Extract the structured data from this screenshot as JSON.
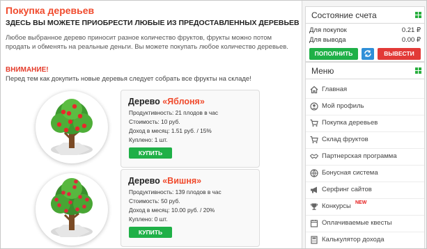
{
  "page": {
    "title": "Покупка деревьев",
    "subtitle": "ЗДЕСЬ ВЫ МОЖЕТЕ ПРИОБРЕСТИ ЛЮБЫЕ ИЗ ПРЕДОСТАВЛЕННЫХ ДЕРЕВЬЕВ",
    "intro": "Любое выбранное дерево приносит разное количество фруктов, фрукты можно потом продать и обменять на реальные деньги. Вы можете покупать любое количество деревьев.",
    "warning_title": "ВНИМАНИЕ!",
    "warning_text": "Перед тем как докупить новые деревья следует собрать все фрукты на складе!"
  },
  "trees": [
    {
      "prefix": "Дерево ",
      "name": "«Яблоня»",
      "productivity": "Продуктивность: 21 плодов в час",
      "cost": "Стоимость: 10 руб.",
      "income": "Доход в месяц: 1.51 руб. / 15%",
      "bought": "Куплено: 1 шт.",
      "buy_label": "КУПИТЬ",
      "fruit_color": "#e8282b"
    },
    {
      "prefix": "Дерево ",
      "name": "«Вишня»",
      "productivity": "Продуктивность: 139 плодов в час",
      "cost": "Стоимость: 50 руб.",
      "income": "Доход в месяц: 10.00 руб. / 20%",
      "bought": "Куплено: 0 шт.",
      "buy_label": "КУПИТЬ",
      "fruit_color": "#e0283c"
    }
  ],
  "account": {
    "title": "Состояние счета",
    "purchase_label": "Для покупок",
    "purchase_value": "0.21 ₽",
    "withdraw_label": "Для вывода",
    "withdraw_value": "0.00 ₽",
    "deposit_button": "ПОПОЛНИТЬ",
    "withdraw_button": "ВЫВЕСТИ"
  },
  "menu": {
    "title": "Меню",
    "items": [
      {
        "label": "Главная",
        "icon": "home-icon"
      },
      {
        "label": "Мой профиль",
        "icon": "user-icon"
      },
      {
        "label": "Покупка деревьев",
        "icon": "cart-icon"
      },
      {
        "label": "Склад фруктов",
        "icon": "cart-icon"
      },
      {
        "label": "Партнерская программа",
        "icon": "handshake-icon"
      },
      {
        "label": "Бонусная система",
        "icon": "globe-icon"
      },
      {
        "label": "Серфинг сайтов",
        "icon": "megaphone-icon"
      },
      {
        "label": "Конкурсы",
        "icon": "trophy-icon",
        "badge": "NEW"
      },
      {
        "label": "Оплачиваемые квесты",
        "icon": "calendar-icon"
      },
      {
        "label": "Калькулятор дохода",
        "icon": "calculator-icon"
      }
    ]
  },
  "colors": {
    "accent": "#f04a2c",
    "green": "#1fb047",
    "blue": "#2f8fd8",
    "red": "#e23a37"
  }
}
